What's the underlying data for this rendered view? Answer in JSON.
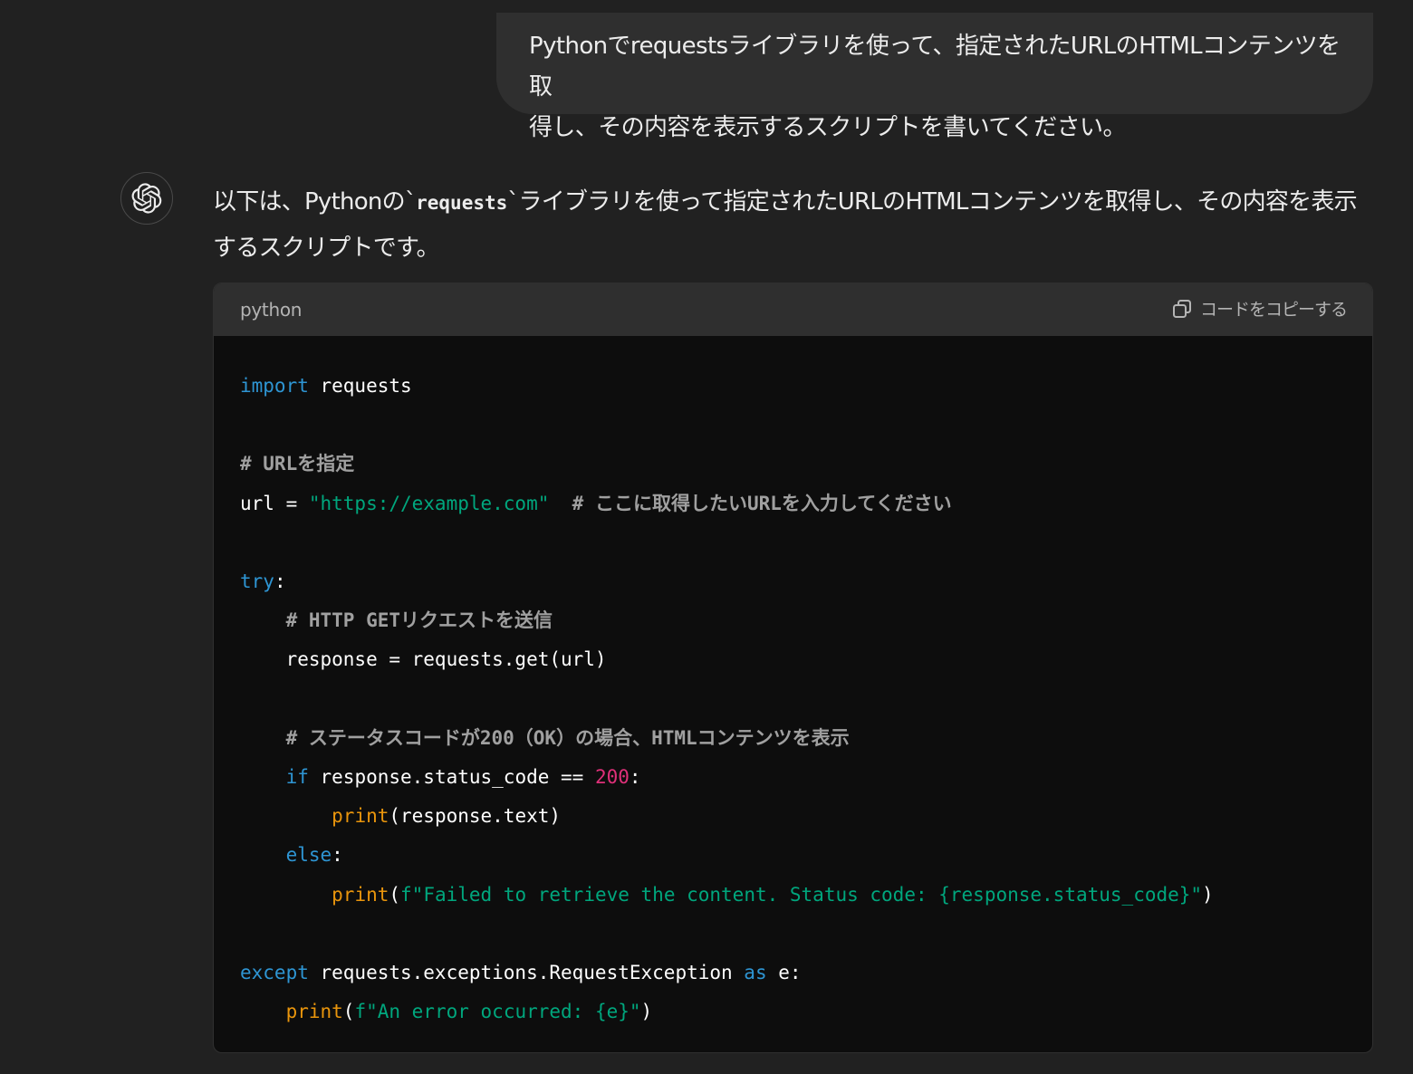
{
  "user_message": {
    "line1": "Pythonでrequestsライブラリを使って、指定されたURLのHTMLコンテンツを取",
    "line2": "得し、その内容を表示するスクリプトを書いてください。"
  },
  "assistant": {
    "avatar_icon": "openai-logo-icon",
    "intro_before": "以下は、Pythonの`",
    "intro_code": "requests",
    "intro_after": "`ライブラリを使って指定されたURLのHTMLコンテンツを取得し、その内容を表示するスクリプトです。"
  },
  "code_block": {
    "language": "python",
    "copy_label": "コードをコピーする",
    "copy_icon": "copy-icon",
    "lines": [
      [
        {
          "t": "kw",
          "v": "import"
        },
        {
          "t": "plain",
          "v": " requests"
        }
      ],
      [],
      [
        {
          "t": "cm",
          "v": "# URLを指定"
        }
      ],
      [
        {
          "t": "plain",
          "v": "url = "
        },
        {
          "t": "str",
          "v": "\"https://example.com\""
        },
        {
          "t": "plain",
          "v": "  "
        },
        {
          "t": "cm",
          "v": "# ここに取得したいURLを入力してください"
        }
      ],
      [],
      [
        {
          "t": "kw",
          "v": "try"
        },
        {
          "t": "plain",
          "v": ":"
        }
      ],
      [
        {
          "t": "plain",
          "v": "    "
        },
        {
          "t": "cm",
          "v": "# HTTP GETリクエストを送信"
        }
      ],
      [
        {
          "t": "plain",
          "v": "    response = requests.get(url)"
        }
      ],
      [],
      [
        {
          "t": "plain",
          "v": "    "
        },
        {
          "t": "cm",
          "v": "# ステータスコードが200（OK）の場合、HTMLコンテンツを表示"
        }
      ],
      [
        {
          "t": "plain",
          "v": "    "
        },
        {
          "t": "kw",
          "v": "if"
        },
        {
          "t": "plain",
          "v": " response.status_code == "
        },
        {
          "t": "num",
          "v": "200"
        },
        {
          "t": "plain",
          "v": ":"
        }
      ],
      [
        {
          "t": "plain",
          "v": "        "
        },
        {
          "t": "bi",
          "v": "print"
        },
        {
          "t": "plain",
          "v": "(response.text)"
        }
      ],
      [
        {
          "t": "plain",
          "v": "    "
        },
        {
          "t": "kw",
          "v": "else"
        },
        {
          "t": "plain",
          "v": ":"
        }
      ],
      [
        {
          "t": "plain",
          "v": "        "
        },
        {
          "t": "bi",
          "v": "print"
        },
        {
          "t": "plain",
          "v": "("
        },
        {
          "t": "str",
          "v": "f\"Failed to retrieve the content. Status code: {response.status_code}\""
        },
        {
          "t": "plain",
          "v": ")"
        }
      ],
      [],
      [
        {
          "t": "kw",
          "v": "except"
        },
        {
          "t": "plain",
          "v": " requests.exceptions.RequestException "
        },
        {
          "t": "kw",
          "v": "as"
        },
        {
          "t": "plain",
          "v": " e:"
        }
      ],
      [
        {
          "t": "plain",
          "v": "    "
        },
        {
          "t": "bi",
          "v": "print"
        },
        {
          "t": "plain",
          "v": "("
        },
        {
          "t": "str",
          "v": "f\"An error occurred: {e}\""
        },
        {
          "t": "plain",
          "v": ")"
        }
      ]
    ]
  },
  "colors": {
    "background": "#212121",
    "user_bubble": "#2f2f2f",
    "code_header": "#2f2f2f",
    "code_background": "#0d0d0d",
    "keyword": "#2e95d3",
    "comment": "#a0a0a0",
    "string": "#00a67d",
    "number": "#df3079",
    "builtin": "#e9950c"
  }
}
